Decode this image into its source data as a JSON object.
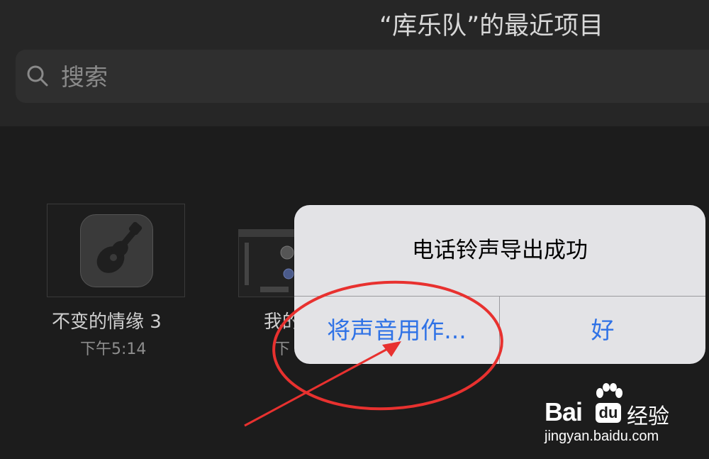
{
  "header": {
    "title": "“库乐队”的最近项目"
  },
  "search": {
    "placeholder": "搜索",
    "icon": "search-icon"
  },
  "projects": [
    {
      "name": "不变的情缘 3",
      "time": "下午5:14",
      "icon": "garageband-guitar-icon"
    },
    {
      "name": "我的",
      "time": "下",
      "icon": "amp-thumbnail-icon"
    }
  ],
  "alert": {
    "title": "电话铃声导出成功",
    "use_as_label": "将声音用作...",
    "ok_label": "好"
  },
  "annotation": {
    "color": "#e8312f"
  },
  "watermark": {
    "brand_left": "Bai",
    "brand_du": "du",
    "brand_cn": "经验",
    "url": "jingyan.baidu.com"
  }
}
